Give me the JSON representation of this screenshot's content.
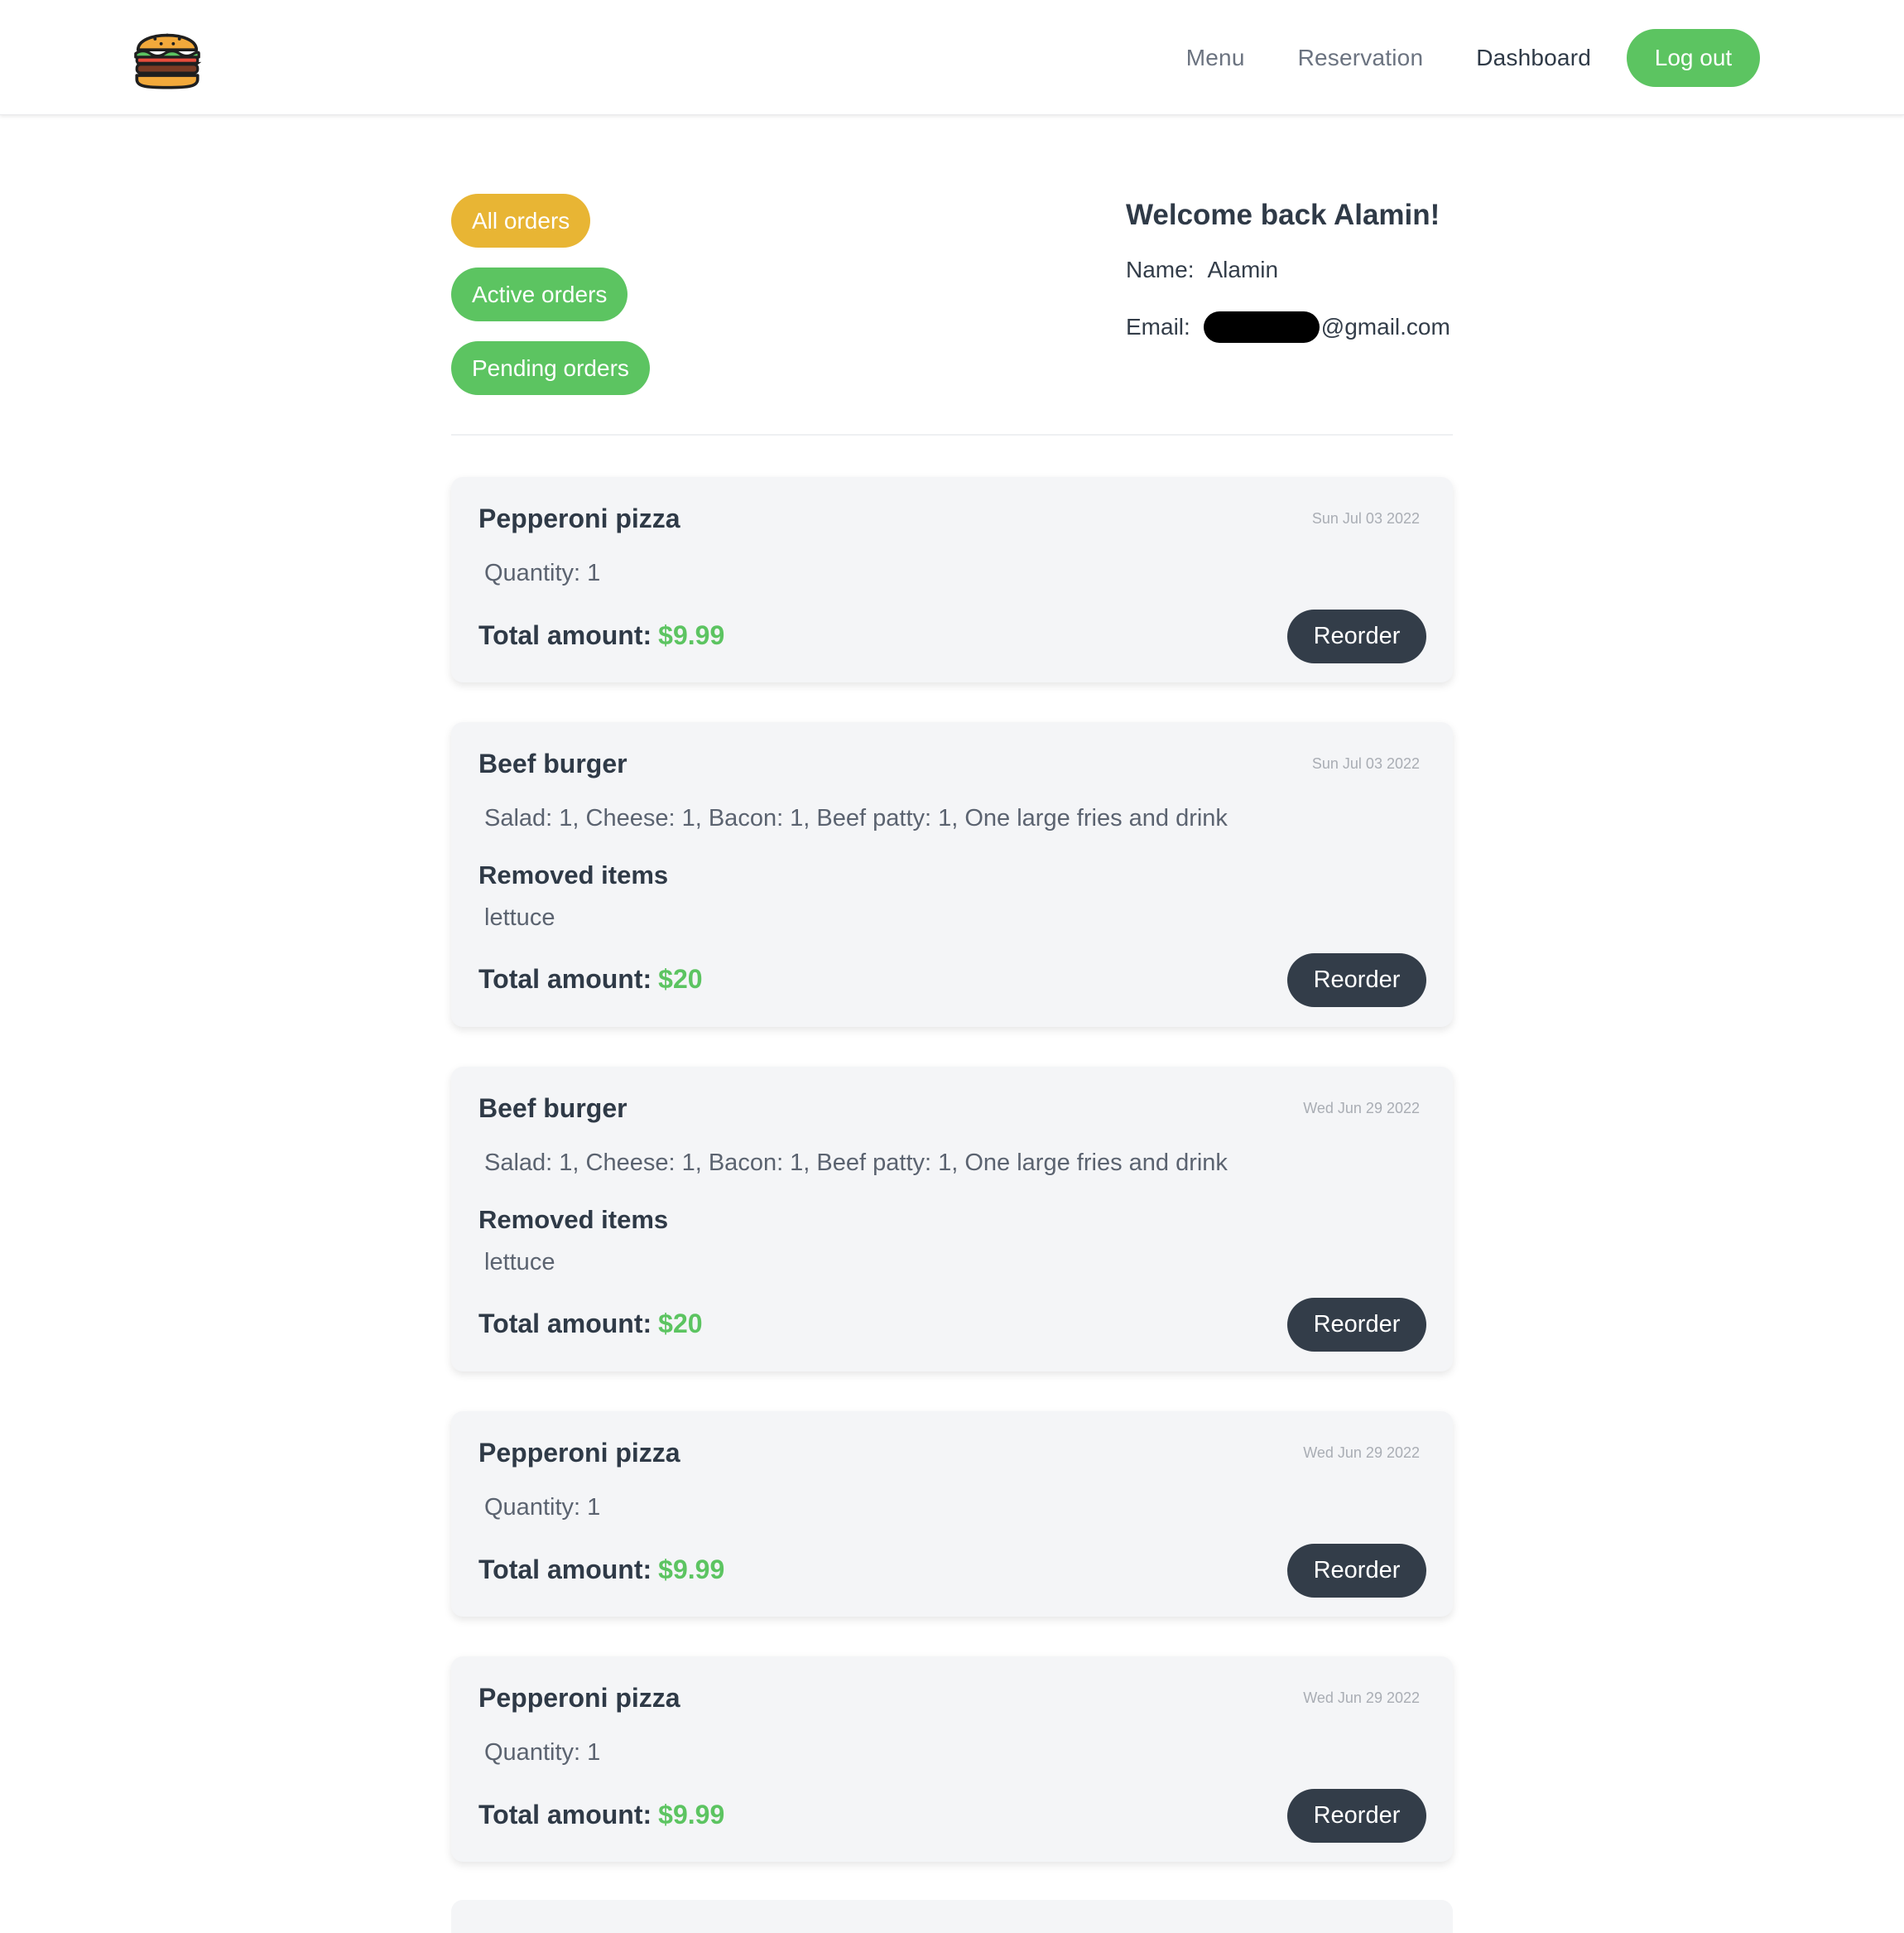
{
  "header": {
    "logo_icon": "burger-icon",
    "nav": {
      "menu": "Menu",
      "reservation": "Reservation",
      "dashboard": "Dashboard",
      "logout": "Log out"
    }
  },
  "filters": {
    "all": "All orders",
    "active": "Active orders",
    "pending": "Pending orders"
  },
  "profile": {
    "welcome": "Welcome back Alamin!",
    "name_label": "Name:",
    "name_value": "Alamin",
    "email_label": "Email:",
    "email_domain": "@gmail.com"
  },
  "colors": {
    "accent_green": "#5cc461",
    "accent_yellow": "#e8b534",
    "dark_button": "#333d49"
  },
  "orders": [
    {
      "title": "Pepperoni pizza",
      "date": "Sun Jul 03 2022",
      "detail": "Quantity: 1",
      "total_label": "Total amount:",
      "amount": "$9.99",
      "reorder": "Reorder"
    },
    {
      "title": "Beef burger",
      "date": "Sun Jul 03 2022",
      "detail": "Salad: 1,  Cheese: 1,  Bacon: 1,  Beef patty: 1,  One large fries and drink",
      "removed_title": "Removed items",
      "removed": "lettuce",
      "total_label": "Total amount:",
      "amount": "$20",
      "reorder": "Reorder"
    },
    {
      "title": "Beef burger",
      "date": "Wed Jun 29 2022",
      "detail": "Salad: 1,  Cheese: 1,  Bacon: 1,  Beef patty: 1,  One large fries and drink",
      "removed_title": "Removed items",
      "removed": "lettuce",
      "total_label": "Total amount:",
      "amount": "$20",
      "reorder": "Reorder"
    },
    {
      "title": "Pepperoni pizza",
      "date": "Wed Jun 29 2022",
      "detail": "Quantity: 1",
      "total_label": "Total amount:",
      "amount": "$9.99",
      "reorder": "Reorder"
    },
    {
      "title": "Pepperoni pizza",
      "date": "Wed Jun 29 2022",
      "detail": "Quantity: 1",
      "total_label": "Total amount:",
      "amount": "$9.99",
      "reorder": "Reorder"
    }
  ]
}
